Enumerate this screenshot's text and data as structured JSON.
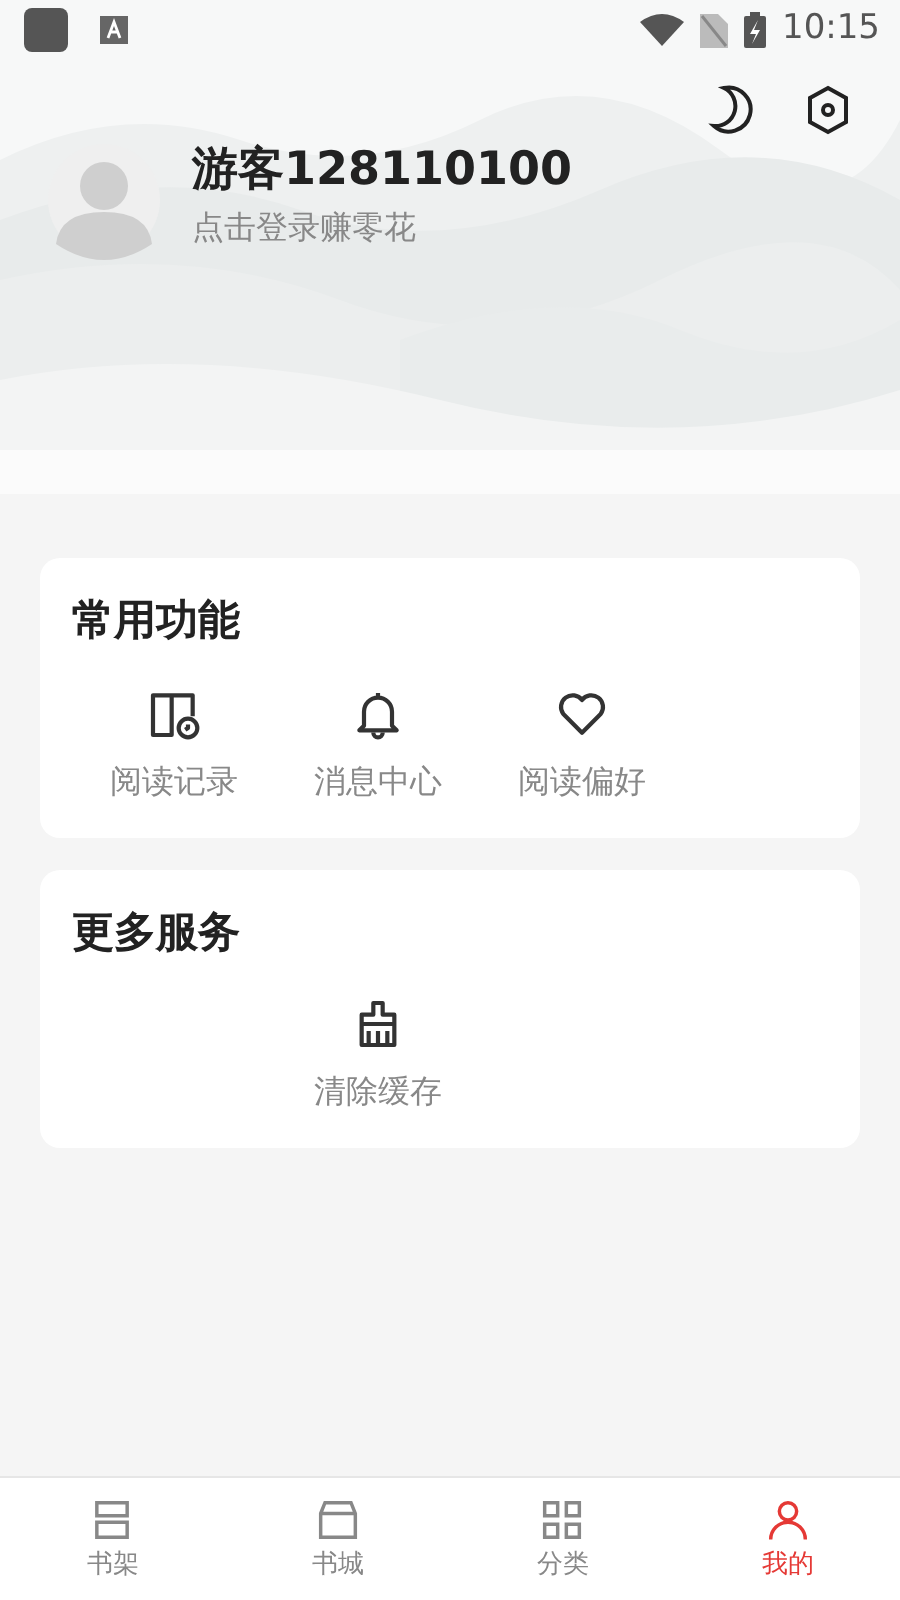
{
  "status_bar": {
    "time": "10:15"
  },
  "profile": {
    "name": "游客128110100",
    "subtitle": "点击登录赚零花"
  },
  "sections": [
    {
      "title": "常用功能",
      "items": [
        {
          "label": "阅读记录",
          "kind": "book"
        },
        {
          "label": "消息中心",
          "kind": "bell"
        },
        {
          "label": "阅读偏好",
          "kind": "heart"
        }
      ]
    },
    {
      "title": "更多服务",
      "items": [
        {
          "kind": "empty"
        },
        {
          "label": "清除缓存",
          "kind": "brush"
        }
      ]
    }
  ],
  "tabs": [
    {
      "label": "书架",
      "kind": "shelf",
      "selected": false
    },
    {
      "label": "书城",
      "kind": "store",
      "selected": false
    },
    {
      "label": "分类",
      "kind": "category",
      "selected": false
    },
    {
      "label": "我的",
      "kind": "me",
      "selected": true
    }
  ]
}
